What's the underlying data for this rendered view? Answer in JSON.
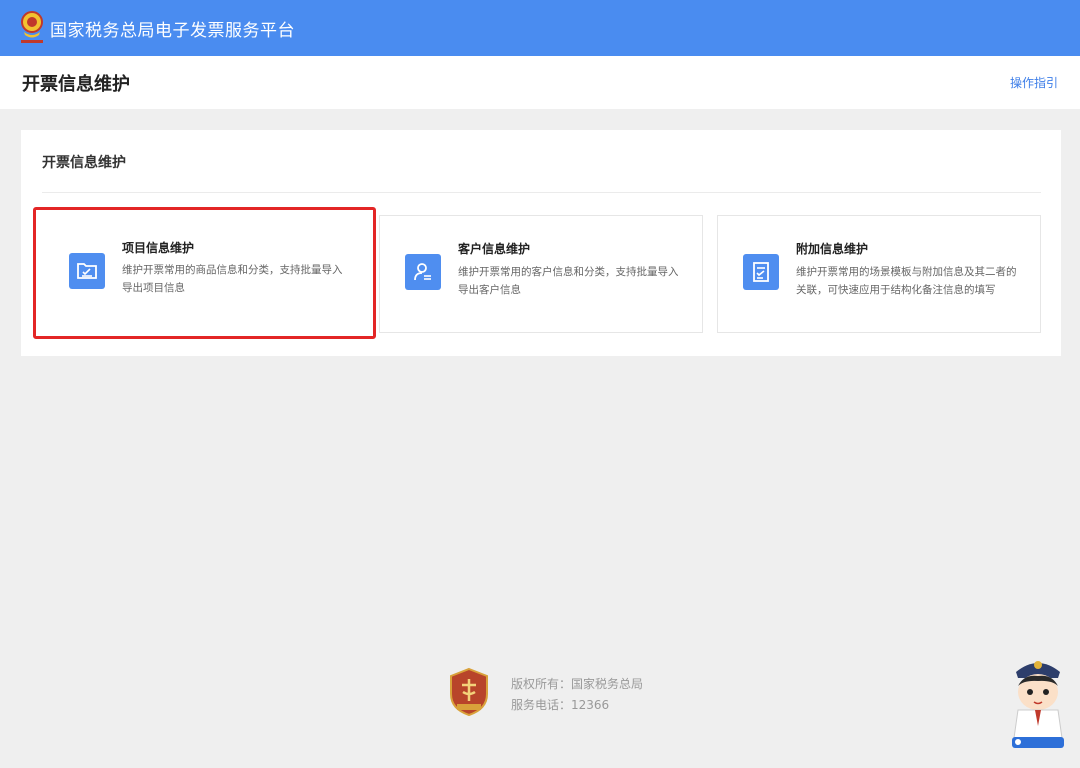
{
  "header": {
    "platform_title": "国家税务总局电子发票服务平台"
  },
  "subheader": {
    "page_title": "开票信息维护",
    "guide_link": "操作指引"
  },
  "panel": {
    "title": "开票信息维护",
    "cards": [
      {
        "name": "项目信息维护",
        "description": "维护开票常用的商品信息和分类，支持批量导入导出项目信息",
        "icon": "folder-edit-icon"
      },
      {
        "name": "客户信息维护",
        "description": "维护开票常用的客户信息和分类，支持批量导入导出客户信息",
        "icon": "contact-card-icon"
      },
      {
        "name": "附加信息维护",
        "description": "维护开票常用的场景模板与附加信息及其二者的关联，可快速应用于结构化备注信息的填写",
        "icon": "document-edit-icon"
      }
    ]
  },
  "footer": {
    "copyright": "版权所有：国家税务总局",
    "phone": "服务电话：12366"
  },
  "colors": {
    "topbar": "#4a8cf0",
    "accent": "#4f8ef0",
    "highlight_border": "#e32626"
  }
}
